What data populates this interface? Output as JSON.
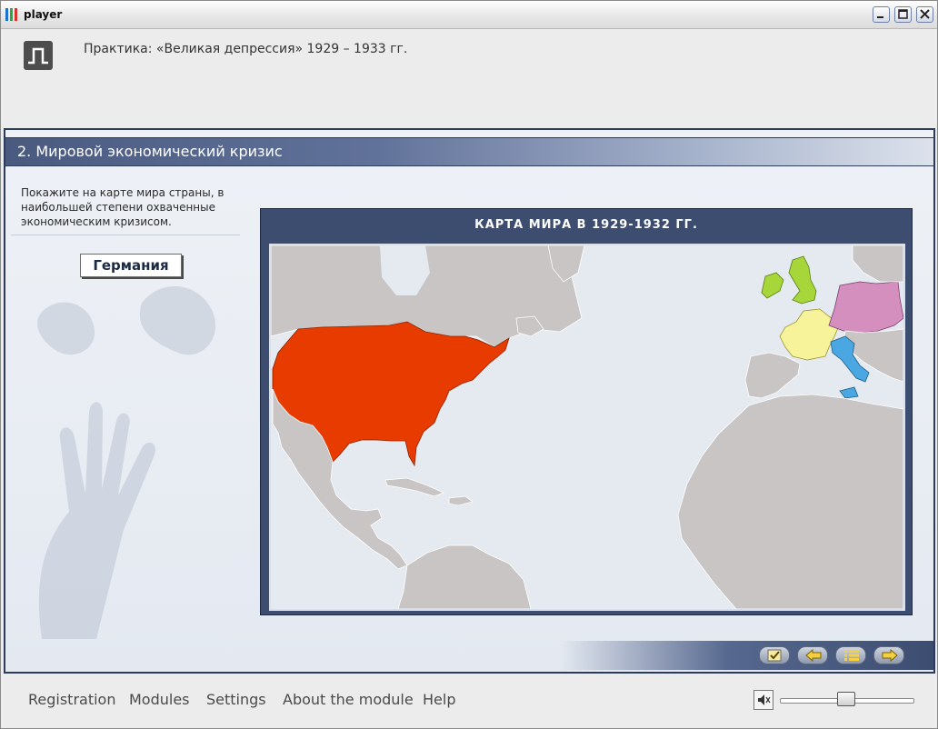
{
  "window": {
    "title": "player"
  },
  "header": {
    "course_title": "Практика: «Великая депрессия» 1929 – 1933 гг."
  },
  "slide": {
    "title": "2. Мировой экономический кризис",
    "instruction": "Покажите на карте мира страны, в наибольшей степени охваченные экономическим кризисом.",
    "answer_button": "Германия"
  },
  "map": {
    "heading": "КАРТА МИРА В 1929-1932 ГГ.",
    "colors": {
      "ocean": "#e4eaf0",
      "land": "#c8c5c4",
      "usa": "#e83b00",
      "uk": "#a6d63a",
      "germany": "#d58fbf",
      "france": "#f6f39a",
      "italy": "#4aa7e2"
    },
    "highlighted": [
      "usa",
      "uk",
      "germany",
      "france",
      "italy"
    ]
  },
  "nav": {
    "buttons": [
      "check-icon",
      "back-arrow-icon",
      "contents-list-icon",
      "next-arrow-icon"
    ]
  },
  "footer": {
    "menu": [
      "Registration",
      "Modules",
      "Settings",
      "About the module",
      "Help"
    ],
    "volume": 0.5
  }
}
